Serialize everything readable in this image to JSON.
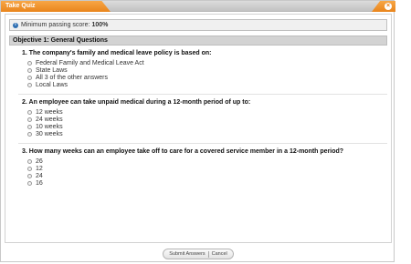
{
  "window": {
    "title": "Take Quiz",
    "close_glyph": "×"
  },
  "info": {
    "label": "Minimum passing score:",
    "value": "100%"
  },
  "objective": {
    "title": "Objective 1: General Questions"
  },
  "questions": [
    {
      "text": "1. The company's family and medical leave policy is based on:",
      "options": [
        "Federal Family and Medical Leave Act",
        "State Laws",
        "All 3 of the other answers",
        "Local Laws"
      ]
    },
    {
      "text": "2. An employee can take unpaid medical during a 12-month period of up to:",
      "options": [
        "12 weeks",
        "24 weeks",
        "10 weeks",
        "30 weeks"
      ]
    },
    {
      "text": "3. How many weeks can an employee take off to care for a covered service member in a 12-month period?",
      "options": [
        "26",
        "12",
        "24",
        "16"
      ]
    }
  ],
  "footer": {
    "submit_label": "Submit Answers",
    "cancel_label": "Cancel"
  },
  "colors": {
    "accent": "#e9851c",
    "info_icon": "#2f6fb2"
  }
}
